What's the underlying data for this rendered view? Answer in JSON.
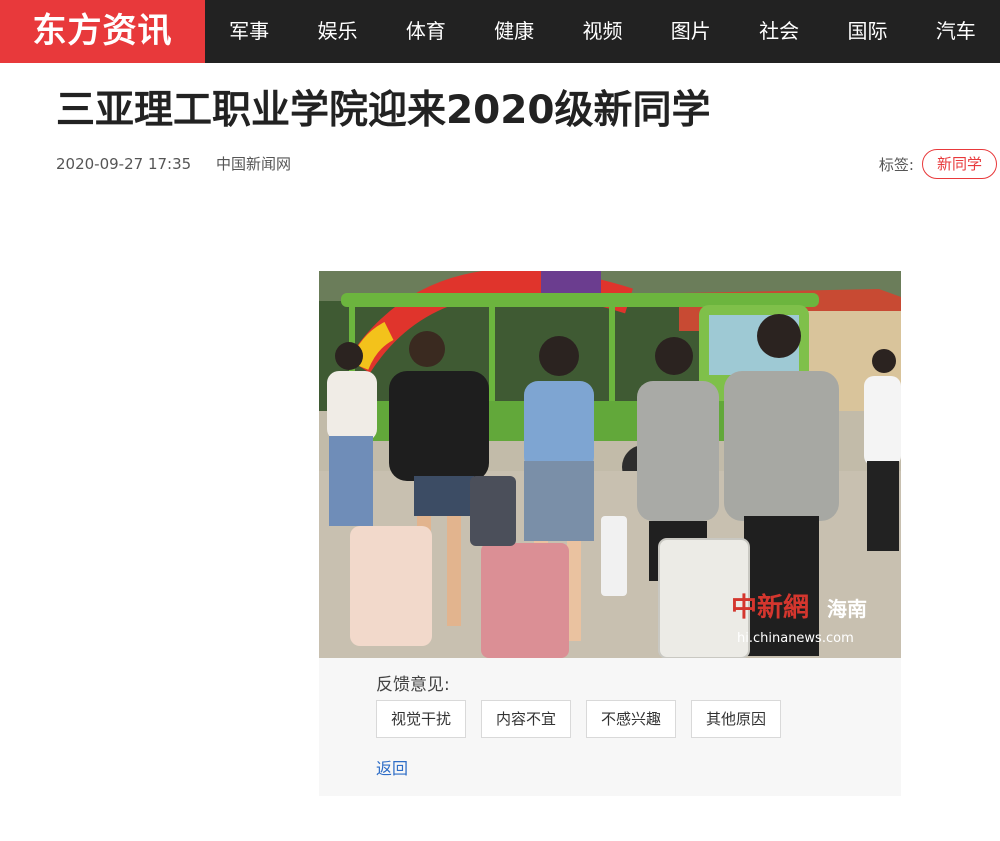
{
  "header": {
    "logo": "东方资讯",
    "nav": [
      "军事",
      "娱乐",
      "体育",
      "健康",
      "视频",
      "图片",
      "社会",
      "国际",
      "汽车"
    ]
  },
  "article": {
    "title": "三亚理工职业学院迎来2020级新同学",
    "date": "2020-09-27 17:35",
    "source": "中国新闻网",
    "tags_label": "标签:",
    "tags": [
      "新同学"
    ]
  },
  "photo": {
    "watermark_brand": "中新網",
    "watermark_region": "海南",
    "watermark_url": "hi.chinanews.com"
  },
  "feedback": {
    "label": "反馈意见:",
    "options": [
      "视觉干扰",
      "内容不宜",
      "不感兴趣",
      "其他原因"
    ],
    "back": "返回"
  },
  "colors": {
    "brand_red": "#e8393b",
    "nav_bg": "#222222",
    "link_blue": "#2e6dc7"
  }
}
